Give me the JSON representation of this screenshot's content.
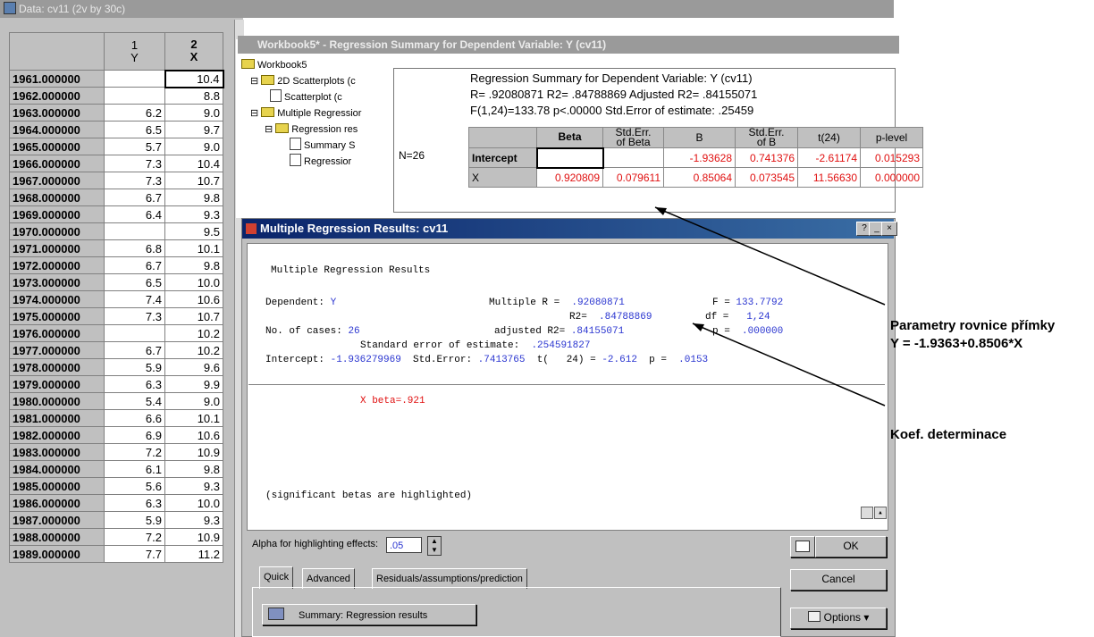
{
  "data_window": {
    "title": "Data: cv11 (2v by 30c)",
    "col1_num": "1",
    "col1_name": "Y",
    "col2_num": "2",
    "col2_name": "X",
    "rows": [
      [
        "1961.000000",
        "",
        "10.4"
      ],
      [
        "1962.000000",
        "",
        "8.8"
      ],
      [
        "1963.000000",
        "6.2",
        "9.0"
      ],
      [
        "1964.000000",
        "6.5",
        "9.7"
      ],
      [
        "1965.000000",
        "5.7",
        "9.0"
      ],
      [
        "1966.000000",
        "7.3",
        "10.4"
      ],
      [
        "1967.000000",
        "7.3",
        "10.7"
      ],
      [
        "1968.000000",
        "6.7",
        "9.8"
      ],
      [
        "1969.000000",
        "6.4",
        "9.3"
      ],
      [
        "1970.000000",
        "",
        "9.5"
      ],
      [
        "1971.000000",
        "6.8",
        "10.1"
      ],
      [
        "1972.000000",
        "6.7",
        "9.8"
      ],
      [
        "1973.000000",
        "6.5",
        "10.0"
      ],
      [
        "1974.000000",
        "7.4",
        "10.6"
      ],
      [
        "1975.000000",
        "7.3",
        "10.7"
      ],
      [
        "1976.000000",
        "",
        "10.2"
      ],
      [
        "1977.000000",
        "6.7",
        "10.2"
      ],
      [
        "1978.000000",
        "5.9",
        "9.6"
      ],
      [
        "1979.000000",
        "6.3",
        "9.9"
      ],
      [
        "1980.000000",
        "5.4",
        "9.0"
      ],
      [
        "1981.000000",
        "6.6",
        "10.1"
      ],
      [
        "1982.000000",
        "6.9",
        "10.6"
      ],
      [
        "1983.000000",
        "7.2",
        "10.9"
      ],
      [
        "1984.000000",
        "6.1",
        "9.8"
      ],
      [
        "1985.000000",
        "5.6",
        "9.3"
      ],
      [
        "1986.000000",
        "6.3",
        "10.0"
      ],
      [
        "1987.000000",
        "5.9",
        "9.3"
      ],
      [
        "1988.000000",
        "7.2",
        "10.9"
      ],
      [
        "1989.000000",
        "7.7",
        "11.2"
      ]
    ]
  },
  "workbook": {
    "title": "Workbook5* - Regression Summary for Dependent Variable: Y (cv11)",
    "tree": [
      "Workbook5",
      "2D Scatterplots (c",
      "Scatterplot (c",
      "Multiple Regressior",
      "Regression res",
      "Summary S",
      "Regressior"
    ]
  },
  "summary": {
    "line1": "Regression Summary for Dependent Variable: Y (cv11)",
    "line2": "R= .92080871 R2= .84788869 Adjusted R2= .84155071",
    "line3": "F(1,24)=133.78 p<.00000 Std.Error of estimate: .25459",
    "n": "N=26",
    "headers": [
      [
        "Beta",
        ""
      ],
      [
        "Std.Err.",
        "of Beta"
      ],
      [
        "B",
        ""
      ],
      [
        "Std.Err.",
        "of B"
      ],
      [
        "t(24)",
        ""
      ],
      [
        "p-level",
        ""
      ]
    ],
    "rows": [
      {
        "name": "Intercept",
        "values": [
          "",
          "",
          "-1.93628",
          "0.741376",
          "-2.61174",
          "0.015293"
        ]
      },
      {
        "name": "X",
        "values": [
          "0.920809",
          "0.079611",
          "0.85064",
          "0.073545",
          "11.56630",
          "0.000000"
        ]
      }
    ]
  },
  "results": {
    "title": "Multiple Regression Results: cv11",
    "heading": "Multiple Regression Results",
    "dependent_label": "Dependent:",
    "dependent_value": "Y",
    "multiple_r_label": "Multiple R =",
    "multiple_r": ".92080871",
    "f_label": "F =",
    "f_value": "133.7792",
    "r2_label": "R2=",
    "r2": ".84788869",
    "df_label": "df =",
    "df_value": "1,24",
    "cases_label": "No. of cases:",
    "cases": "26",
    "adj_r2_label": "adjusted R2=",
    "adj_r2": ".84155071",
    "p_label": "p =",
    "p_value": ".000000",
    "se_label": "Standard error of estimate:",
    "se_value": ".254591827",
    "intercept_label": "Intercept:",
    "intercept": "-1.936279969",
    "stderr_label": "Std.Error:",
    "stderr": ".7413765",
    "t_label": "t(   24) =",
    "t_value": "-2.612",
    "p2_label": "p =",
    "p2_value": ".0153",
    "beta_text": "X beta=.921",
    "note": "(significant betas are highlighted)"
  },
  "controls": {
    "alpha_label": "Alpha for highlighting effects:",
    "alpha_value": ".05",
    "ok": "OK",
    "cancel": "Cancel",
    "options": "Options",
    "tabs": [
      "Quick",
      "Advanced",
      "Residuals/assumptions/prediction"
    ],
    "summary_button": "Summary:  Regression results"
  },
  "annotations": {
    "params_line1": "Parametry rovnice přímky",
    "params_line2": "Y = -1.9363+0.8506*X",
    "determ": "Koef. determinace"
  }
}
